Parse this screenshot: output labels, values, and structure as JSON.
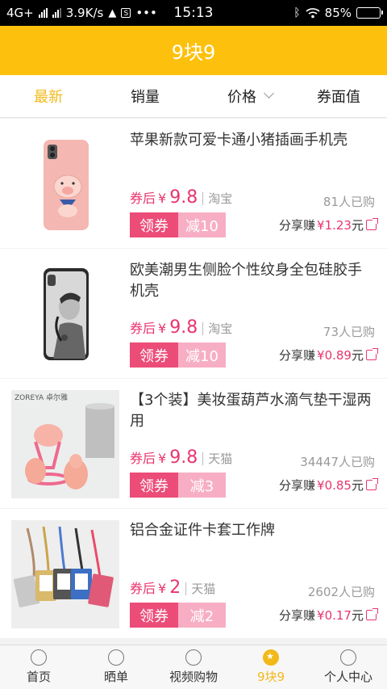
{
  "status_bar": {
    "network": "4G+",
    "speed": "3.9K/s",
    "s_badge": "S",
    "dots": "•••",
    "time": "15:13",
    "battery": "85%",
    "battery_level": 0.85
  },
  "header": {
    "title": "9块9"
  },
  "sort_tabs": [
    {
      "label": "最新"
    },
    {
      "label": "销量"
    },
    {
      "label": "价格"
    },
    {
      "label": "券面值"
    }
  ],
  "products": [
    {
      "title": "苹果新款可爱卡通小猪插画手机壳",
      "price_label": "券后",
      "currency": "¥",
      "price": "9.8",
      "platform": "淘宝",
      "sold": "81人已购",
      "coupon_label": "领券",
      "discount": "减10",
      "share_label": "分享赚",
      "share_amount": "¥1.23",
      "share_unit": "元"
    },
    {
      "title": "欧美潮男生侧脸个性纹身全包硅胶手机壳",
      "price_label": "券后",
      "currency": "¥",
      "price": "9.8",
      "platform": "淘宝",
      "sold": "73人已购",
      "coupon_label": "领券",
      "discount": "减10",
      "share_label": "分享赚",
      "share_amount": "¥0.89",
      "share_unit": "元"
    },
    {
      "title": "【3个装】美妆蛋葫芦水滴气垫干湿两用",
      "price_label": "券后",
      "currency": "¥",
      "price": "9.8",
      "platform": "天猫",
      "sold": "34447人已购",
      "coupon_label": "领券",
      "discount": "减3",
      "share_label": "分享赚",
      "share_amount": "¥0.85",
      "share_unit": "元",
      "image_brand": "ZOREYA 卓尔雅"
    },
    {
      "title": "铝合金证件卡套工作牌",
      "price_label": "券后",
      "currency": "¥",
      "price": "2",
      "platform": "天猫",
      "sold": "2602人已购",
      "coupon_label": "领券",
      "discount": "减2",
      "share_label": "分享赚",
      "share_amount": "¥0.17",
      "share_unit": "元"
    }
  ],
  "bottom_nav": [
    {
      "label": "首页",
      "icon": "home-icon"
    },
    {
      "label": "晒单",
      "icon": "share-order-icon"
    },
    {
      "label": "视频购物",
      "icon": "video-icon"
    },
    {
      "label": "9块9",
      "icon": "star-icon"
    },
    {
      "label": "个人中心",
      "icon": "profile-icon"
    }
  ],
  "colors": {
    "brand_yellow": "#fdc10d",
    "accent_pink": "#e9356e",
    "coupon_dark": "#ec4c78",
    "coupon_light": "#f7aec4"
  }
}
